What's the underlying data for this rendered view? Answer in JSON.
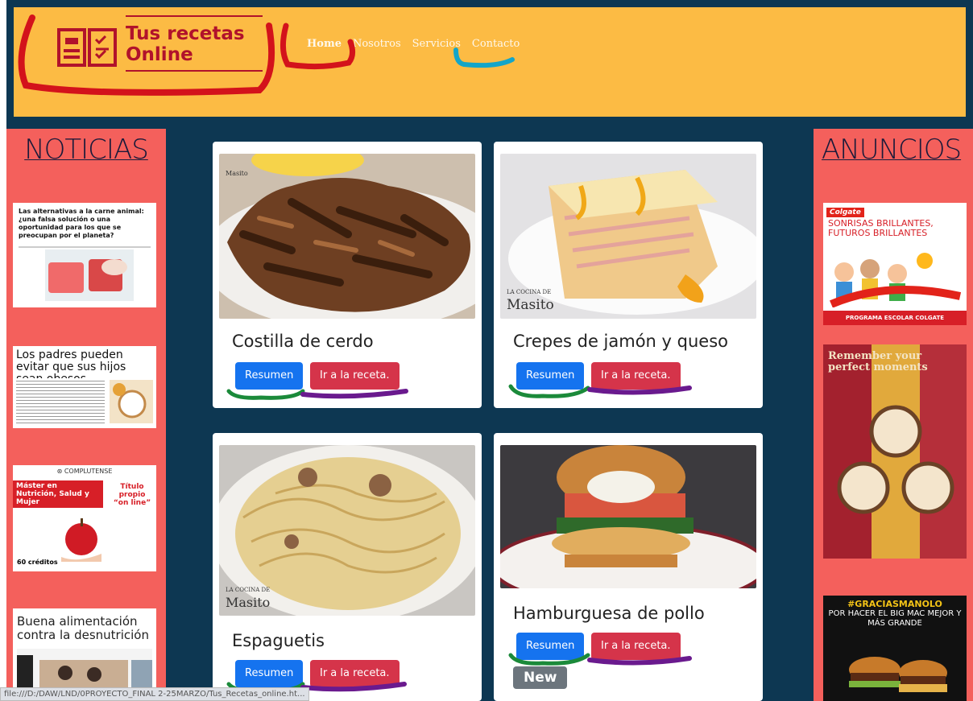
{
  "header": {
    "logo_line1": "Tus recetas",
    "logo_line2": "Online",
    "nav": [
      "Home",
      "Nosotros",
      "Servicios",
      "Contacto"
    ]
  },
  "sidebar_left": {
    "title": "NOTICIAS",
    "news": [
      "Las alternativas a la carne animal: ¿una falsa solución o una oportunidad para los que se preocupan por el planeta?",
      "Los padres pueden evitar que sus hijos sean obesos",
      "Máster en Nutrición, Salud y Mujer",
      "Título propio “on line”",
      "60 créditos",
      "Buena alimentación contra la desnutrición"
    ]
  },
  "sidebar_right": {
    "title": "ANUNCIOS",
    "ads": [
      "Colgate",
      "SONRISAS BRILLANTES, FUTUROS BRILLANTES",
      "PROGRAMA ESCOLAR COLGATE",
      "Remember your perfect moments",
      "#GRACIASMANOLO",
      "POR HACER EL BIG MAC MEJOR Y MÁS GRANDE"
    ]
  },
  "photo_caption": {
    "small": "LA COCINA DE",
    "big": "Masito"
  },
  "recipes": [
    {
      "title": "Costilla de cerdo",
      "summary_label": "Resumen",
      "recipe_label": "Ir a la receta."
    },
    {
      "title": "Crepes de jamón y queso",
      "summary_label": "Resumen",
      "recipe_label": "Ir a la receta."
    },
    {
      "title": "Espaguetis",
      "summary_label": "Resumen",
      "recipe_label": "Ir a la receta."
    },
    {
      "title": "Hamburguesa de pollo",
      "summary_label": "Resumen",
      "recipe_label": "Ir a la receta.",
      "badge": "New"
    }
  ],
  "status_bar": "file:///D:/DAW/LND/0PROYECTO_FINAL 2-25MARZO/Tus_Recetas_online.ht...",
  "colors": {
    "header": "#fcbb44",
    "background": "#0d3752",
    "sidebar": "#f4605c",
    "brand": "#b1122b",
    "primary": "#1573ef",
    "danger": "#d5344a"
  }
}
